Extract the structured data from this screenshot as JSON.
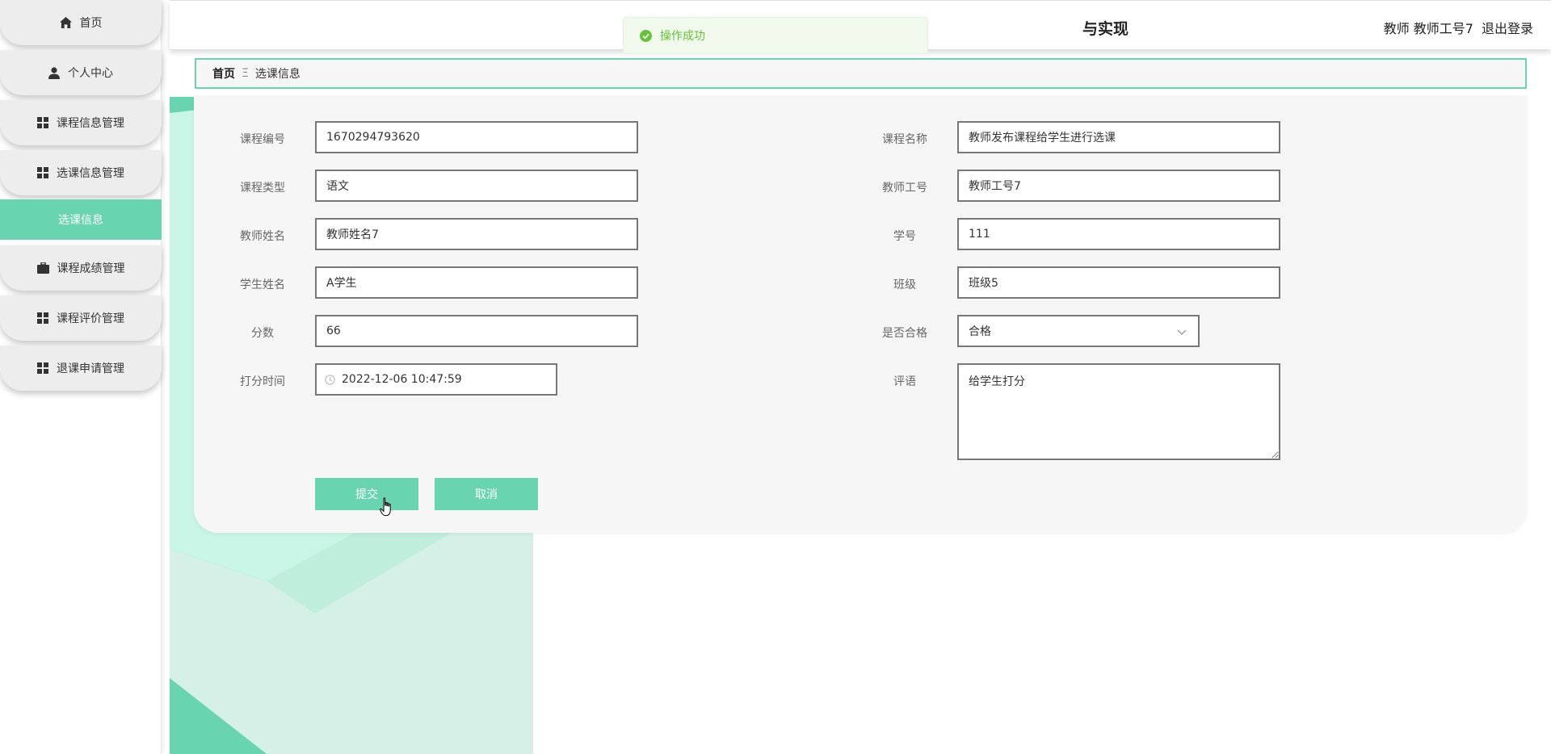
{
  "sidebar": {
    "items": [
      {
        "label": "首页",
        "icon": "home-icon"
      },
      {
        "label": "个人中心",
        "icon": "person-icon"
      },
      {
        "label": "课程信息管理",
        "icon": "grid-icon"
      },
      {
        "label": "选课信息管理",
        "icon": "grid-icon"
      },
      {
        "label": "选课信息",
        "icon": ""
      },
      {
        "label": "课程成绩管理",
        "icon": "briefcase-icon"
      },
      {
        "label": "课程评价管理",
        "icon": "grid-icon"
      },
      {
        "label": "退课申请管理",
        "icon": "grid-icon"
      }
    ],
    "active_color": "#69d5b0"
  },
  "header": {
    "title_fragment": "与实现",
    "user": "教师 教师工号7",
    "logout": "退出登录"
  },
  "toast": {
    "message": "操作成功",
    "color": "#67c23a"
  },
  "breadcrumb": {
    "home": "首页",
    "separator": "Ξ",
    "current": "选课信息"
  },
  "form": {
    "course_id": {
      "label": "课程编号",
      "value": "1670294793620"
    },
    "course_name": {
      "label": "课程名称",
      "value": "教师发布课程给学生进行选课"
    },
    "course_type": {
      "label": "课程类型",
      "value": "语文"
    },
    "teacher_id": {
      "label": "教师工号",
      "value": "教师工号7"
    },
    "teacher_name": {
      "label": "教师姓名",
      "value": "教师姓名7"
    },
    "student_id": {
      "label": "学号",
      "value": "111"
    },
    "student_name": {
      "label": "学生姓名",
      "value": "A学生"
    },
    "class": {
      "label": "班级",
      "value": "班级5"
    },
    "score": {
      "label": "分数",
      "value": "66"
    },
    "passed": {
      "label": "是否合格",
      "value": "合格"
    },
    "score_time": {
      "label": "打分时间",
      "value": "2022-12-06 10:47:59"
    },
    "comment": {
      "label": "评语",
      "value": "给学生打分"
    }
  },
  "buttons": {
    "submit": "提交",
    "cancel": "取消",
    "color": "#69d5b0"
  }
}
